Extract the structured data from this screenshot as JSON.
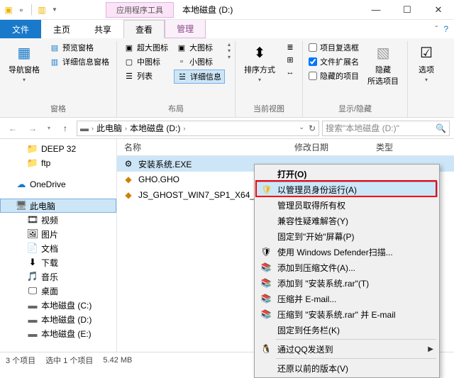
{
  "title": "本地磁盘 (D:)",
  "contextual_tab": "应用程序工具",
  "tabs": {
    "file": "文件",
    "home": "主页",
    "share": "共享",
    "view": "查看",
    "manage": "管理"
  },
  "ribbon": {
    "nav_pane": "导航窗格",
    "preview_pane": "预览窗格",
    "info_pane": "详细信息窗格",
    "extra_large": "超大图标",
    "large": "大图标",
    "medium": "中图标",
    "small": "小图标",
    "list_view": "列表",
    "details": "详细信息",
    "sort": "排序方式",
    "item_checkboxes": "项目复选框",
    "file_ext": "文件扩展名",
    "hidden_items": "隐藏的项目",
    "hide_selected": "隐藏\n所选项目",
    "options": "选项",
    "g_panes": "窗格",
    "g_layout": "布局",
    "g_current": "当前视图",
    "g_showhide": "显示/隐藏"
  },
  "breadcrumb": {
    "pc": "此电脑",
    "drive": "本地磁盘 (D:)"
  },
  "search_placeholder": "搜索\"本地磁盘 (D:)\"",
  "tree": {
    "deep32": "DEEP 32",
    "ftp": "ftp",
    "onedrive": "OneDrive",
    "thispc": "此电脑",
    "videos": "视频",
    "pictures": "图片",
    "documents": "文档",
    "downloads": "下载",
    "music": "音乐",
    "desktop": "桌面",
    "drive_c": "本地磁盘 (C:)",
    "drive_d": "本地磁盘 (D:)",
    "drive_e": "本地磁盘 (E:)"
  },
  "columns": {
    "name": "名称",
    "modified": "修改日期",
    "type": "类型"
  },
  "files": {
    "f0": "安装系统.EXE",
    "f1": "GHO.GHO",
    "f2": "JS_GHOST_WIN7_SP1_X64_"
  },
  "context_menu": {
    "open": "打开(O)",
    "run_admin": "以管理员身份运行(A)",
    "admin_ownership": "管理员取得所有权",
    "troubleshoot": "兼容性疑难解答(Y)",
    "pin_start": "固定到\"开始\"屏幕(P)",
    "defender": "使用 Windows Defender扫描...",
    "add_archive": "添加到压缩文件(A)...",
    "add_rar": "添加到 \"安装系统.rar\"(T)",
    "email": "压缩并 E-mail...",
    "rar_email": "压缩到 \"安装系统.rar\" 并 E-mail",
    "pin_taskbar": "固定到任务栏(K)",
    "qq_send": "通过QQ发送到",
    "restore": "还原以前的版本(V)"
  },
  "status": {
    "count": "3 个项目",
    "selected": "选中 1 个项目",
    "size": "5.42 MB"
  }
}
